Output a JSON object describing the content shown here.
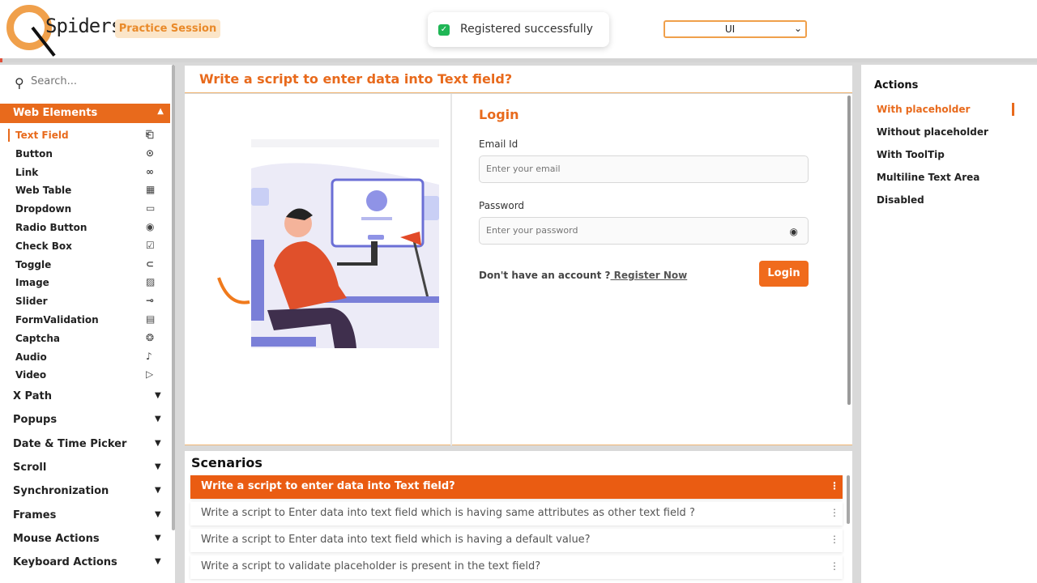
{
  "header": {
    "brand": "Spiders",
    "badge": "Practice Session",
    "toast": "Registered successfully",
    "select_value": "UI"
  },
  "sidebar": {
    "search_placeholder": "Search...",
    "section": "Web Elements",
    "items": [
      {
        "label": "Text Field",
        "icon": "text-field-icon",
        "glyph": "⎗"
      },
      {
        "label": "Button",
        "icon": "play-circle-icon",
        "glyph": "⊙"
      },
      {
        "label": "Link",
        "icon": "link-icon",
        "glyph": "∞"
      },
      {
        "label": "Web Table",
        "icon": "table-icon",
        "glyph": "▦"
      },
      {
        "label": "Dropdown",
        "icon": "dropdown-icon",
        "glyph": "▭"
      },
      {
        "label": "Radio Button",
        "icon": "radio-icon",
        "glyph": "◉"
      },
      {
        "label": "Check Box",
        "icon": "checkbox-icon",
        "glyph": "☑"
      },
      {
        "label": "Toggle",
        "icon": "toggle-icon",
        "glyph": "⊂"
      },
      {
        "label": "Image",
        "icon": "image-icon",
        "glyph": "▨"
      },
      {
        "label": "Slider",
        "icon": "slider-icon",
        "glyph": "⊸"
      },
      {
        "label": "FormValidation",
        "icon": "form-icon",
        "glyph": "▤"
      },
      {
        "label": "Captcha",
        "icon": "captcha-icon",
        "glyph": "❂"
      },
      {
        "label": "Audio",
        "icon": "audio-icon",
        "glyph": "♪"
      },
      {
        "label": "Video",
        "icon": "video-icon",
        "glyph": "▷"
      }
    ],
    "categories": [
      "X Path",
      "Popups",
      "Date & Time Picker",
      "Scroll",
      "Synchronization",
      "Frames",
      "Mouse Actions",
      "Keyboard Actions"
    ]
  },
  "main": {
    "title": "Write a script to enter data into Text field?",
    "login": {
      "title": "Login",
      "email_label": "Email Id",
      "email_placeholder": "Enter your email",
      "password_label": "Password",
      "password_placeholder": "Enter your password",
      "no_account": "Don't have an account ?",
      "register": " Register Now",
      "button": "Login"
    }
  },
  "scenarios": {
    "title": "Scenarios",
    "items": [
      "Write a script to enter data into Text field?",
      "Write a script to Enter data into text field which is having same attributes as other text field ?",
      "Write a script to Enter data into text field which is having a default value?",
      "Write a script to validate placeholder is present in the text field?"
    ]
  },
  "actions": {
    "title": "Actions",
    "items": [
      "With placeholder",
      "Without placeholder",
      "With ToolTip",
      "Multiline Text Area",
      "Disabled"
    ]
  },
  "colors": {
    "accent": "#e86a1c",
    "success": "#1fb655"
  }
}
